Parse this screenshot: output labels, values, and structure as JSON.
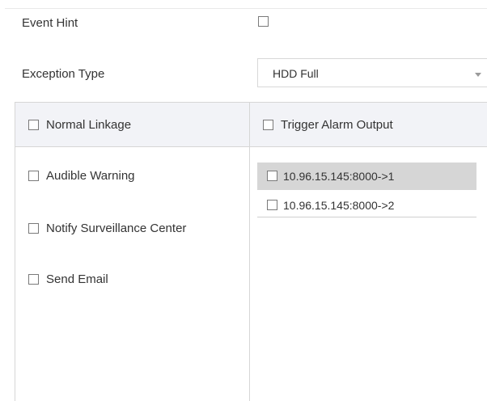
{
  "form": {
    "event_hint_label": "Event Hint",
    "exception_type_label": "Exception Type",
    "exception_type_value": "HDD Full"
  },
  "linkage": {
    "normal_header": "Normal Linkage",
    "trigger_header": "Trigger Alarm Output",
    "normal_items": [
      {
        "label": "Audible Warning"
      },
      {
        "label": "Notify Surveillance Center"
      },
      {
        "label": "Send Email"
      }
    ],
    "alarm_outputs": [
      {
        "label": "10.96.15.145:8000->1"
      },
      {
        "label": "10.96.15.145:8000->2"
      }
    ]
  }
}
